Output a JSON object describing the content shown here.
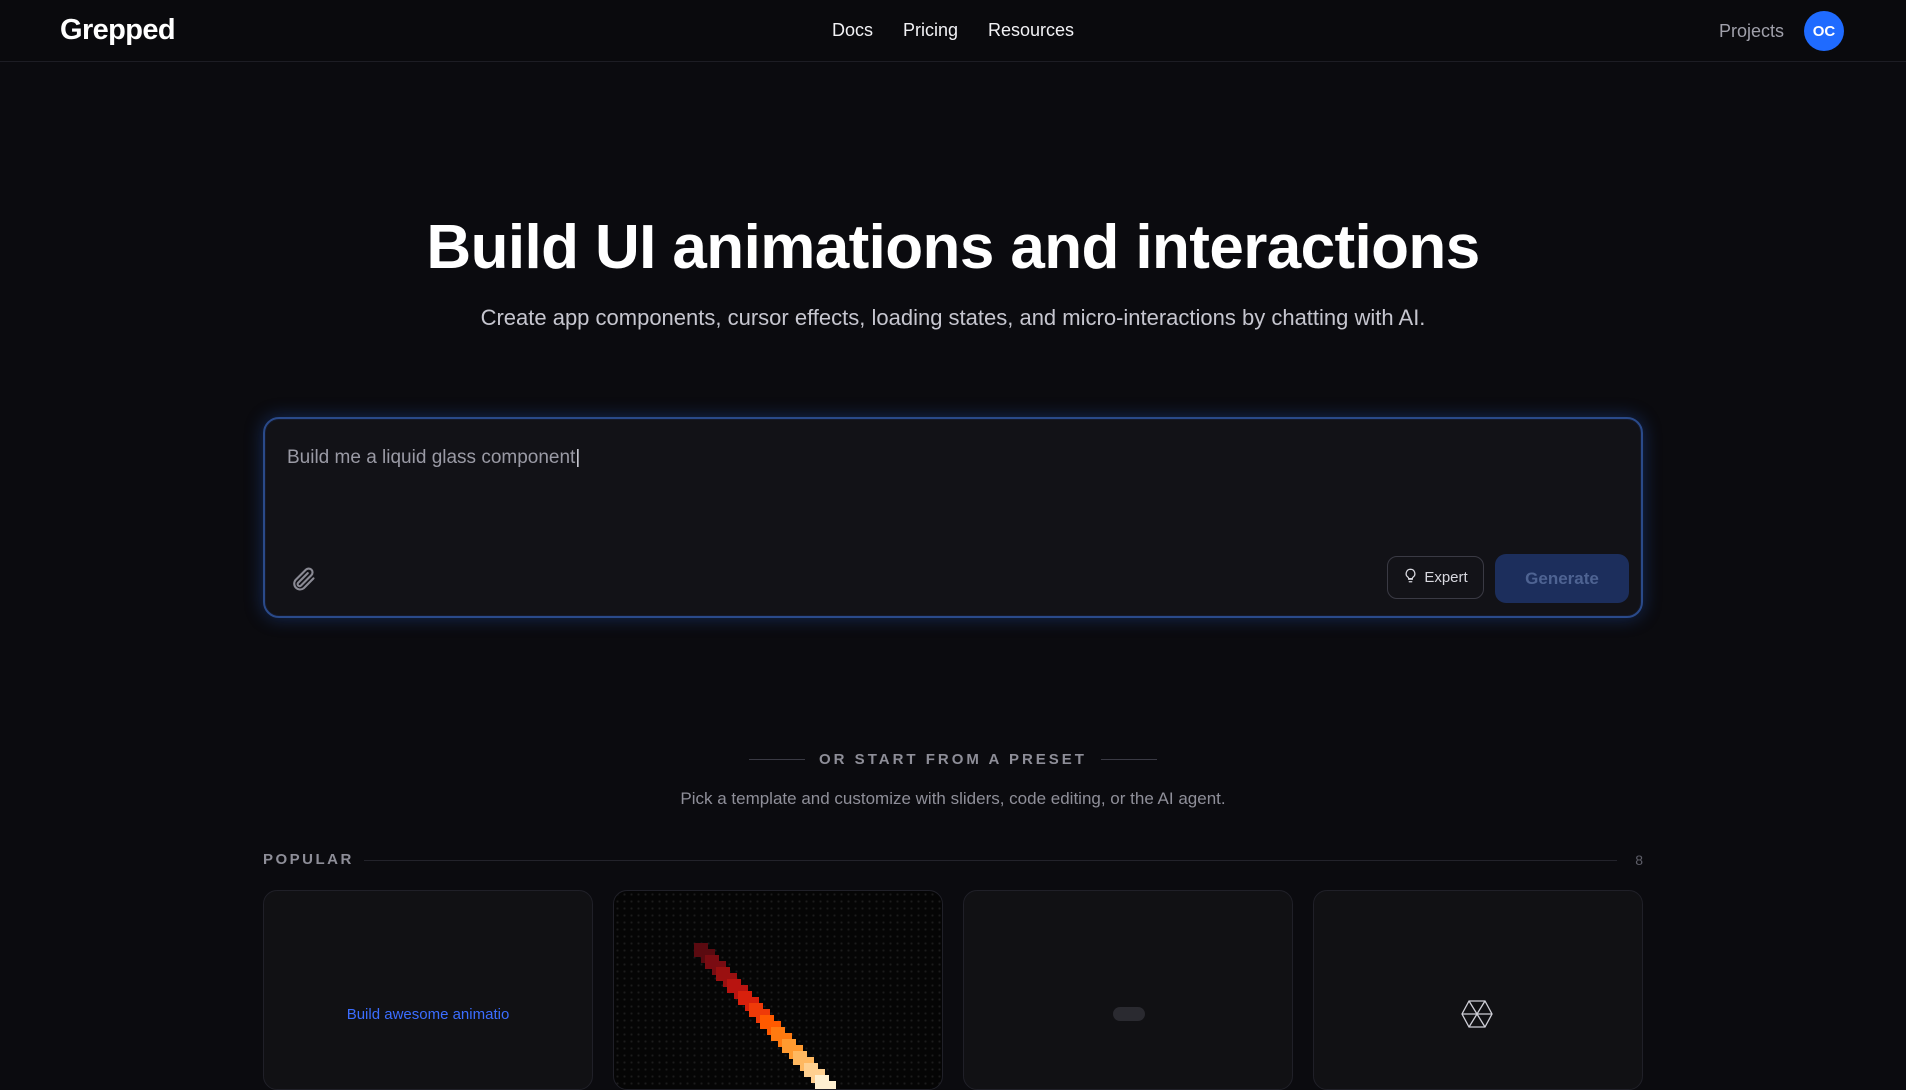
{
  "header": {
    "logo": "Grepped",
    "nav": [
      "Docs",
      "Pricing",
      "Resources"
    ],
    "projects_label": "Projects",
    "avatar_initials": "OC"
  },
  "hero": {
    "title": "Build UI animations and interactions",
    "subtitle": "Create app components, cursor effects, loading states, and micro-interactions by chatting with AI."
  },
  "prompt": {
    "value": "Build me a liquid glass component",
    "expert_label": "Expert",
    "generate_label": "Generate",
    "attach_icon": "paperclip-icon",
    "expert_icon": "lightbulb-icon"
  },
  "presets": {
    "heading": "OR START FROM A PRESET",
    "description": "Pick a template and customize with sliders, code editing, or the AI agent.",
    "popular_label": "POPULAR",
    "popular_count": "8",
    "cards": [
      {
        "preview_text": "Build awesome animatio"
      },
      {
        "preview": "pixel-trail"
      },
      {
        "preview": "pill"
      },
      {
        "preview": "cube-logo-icon"
      }
    ]
  },
  "colors": {
    "accent": "#1f6bff",
    "background": "#0b0b0f",
    "focus_ring": "#2a4a8a",
    "generate_bg": "#1c2e5c"
  }
}
